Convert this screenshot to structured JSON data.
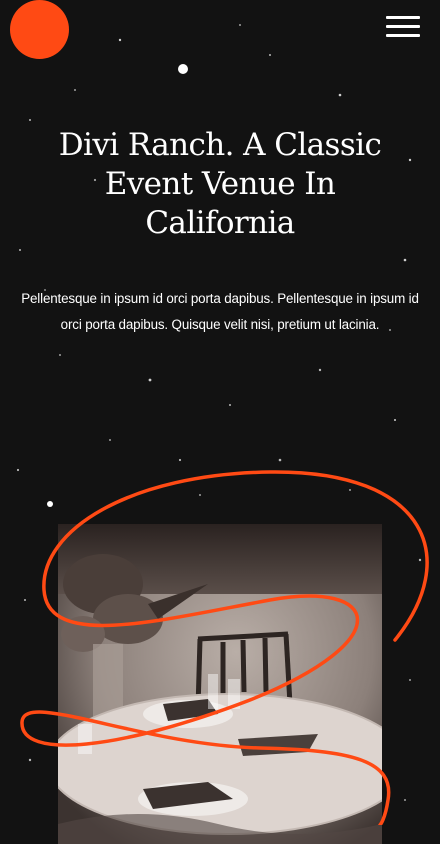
{
  "header": {
    "logo_icon": "orange-circle-logo",
    "menu_icon": "hamburger-icon"
  },
  "hero": {
    "title": "Divi Ranch. A Classic Event Venue In California",
    "body": "Pellentesque in ipsum id orci porta dapibus. Pellentesque in ipsum id orci porta dapibus. Quisque velit nisi, pretium ut lacinia."
  },
  "colors": {
    "background": "#121212",
    "accent": "#ff4a14",
    "text": "#ffffff"
  }
}
